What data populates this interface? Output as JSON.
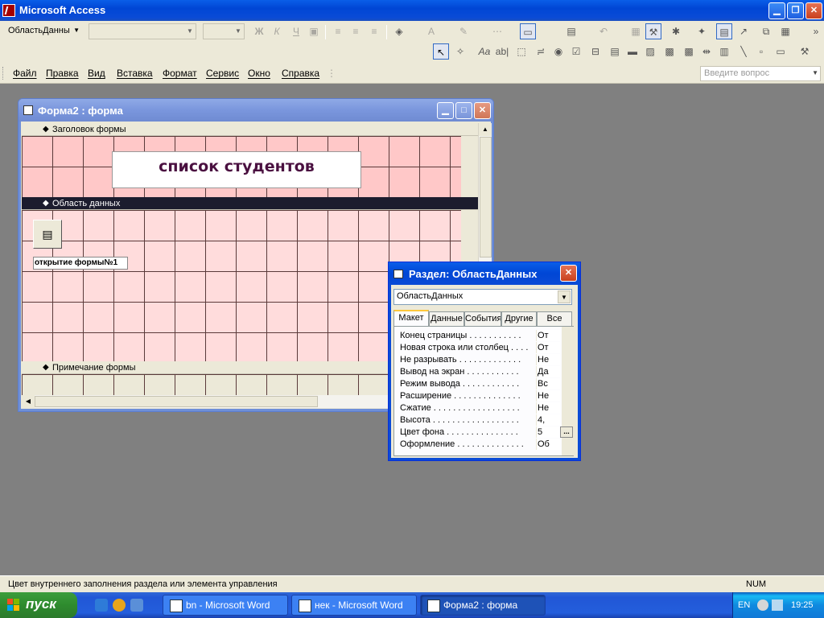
{
  "app": {
    "title": "Microsoft Access"
  },
  "toolbar": {
    "object_combo": "ОбластьДанны",
    "font_combo": "",
    "size_combo": ""
  },
  "menu": [
    "Файл",
    "Правка",
    "Вид",
    "Вставка",
    "Формат",
    "Сервис",
    "Окно",
    "Справка"
  ],
  "ask_placeholder": "Введите вопрос",
  "form_window": {
    "title": "Форма2 : форма",
    "sections": {
      "header": "Заголовок формы",
      "detail": "Область данных",
      "footer": "Примечание формы"
    },
    "title_label": "список студентов",
    "command_label": "открытие формы№1"
  },
  "props": {
    "title": "Раздел: ОбластьДанных",
    "object": "ОбластьДанных",
    "tabs": [
      "Макет",
      "Данные",
      "События",
      "Другие",
      "Все"
    ],
    "active_tab": "Макет",
    "rows": [
      {
        "name": "Конец страницы . . . . . . . . . . .",
        "value": "От"
      },
      {
        "name": "Новая строка или столбец . . . .",
        "value": "От"
      },
      {
        "name": "Не разрывать . . . . . . . . . . . . .",
        "value": "Не"
      },
      {
        "name": "Вывод на экран . . . . . . . . . . .",
        "value": "Да"
      },
      {
        "name": "Режим вывода . . . . . . . . . . . .",
        "value": "Вс"
      },
      {
        "name": "Расширение . . . . . . . . . . . . . .",
        "value": "Не"
      },
      {
        "name": "Сжатие . . . . . . . . . . . . . . . . . .",
        "value": "Не"
      },
      {
        "name": "Высота . . . . . . . . . . . . . . . . . .",
        "value": "4,"
      },
      {
        "name": "Цвет фона . . . . . . . . . . . . . . .",
        "value": "5"
      },
      {
        "name": "Оформление . . . . . . . . . . . . . .",
        "value": "Об"
      }
    ],
    "dots_button": "..."
  },
  "status": {
    "text": "Цвет внутреннего заполнения раздела или элемента управления",
    "num": "NUM"
  },
  "taskbar": {
    "start": "пуск",
    "tasks": [
      {
        "label": "bn - Microsoft Word"
      },
      {
        "label": "нек - Microsoft Word"
      },
      {
        "label": "Форма2 : форма"
      }
    ],
    "lang": "EN",
    "clock": "19:25"
  }
}
